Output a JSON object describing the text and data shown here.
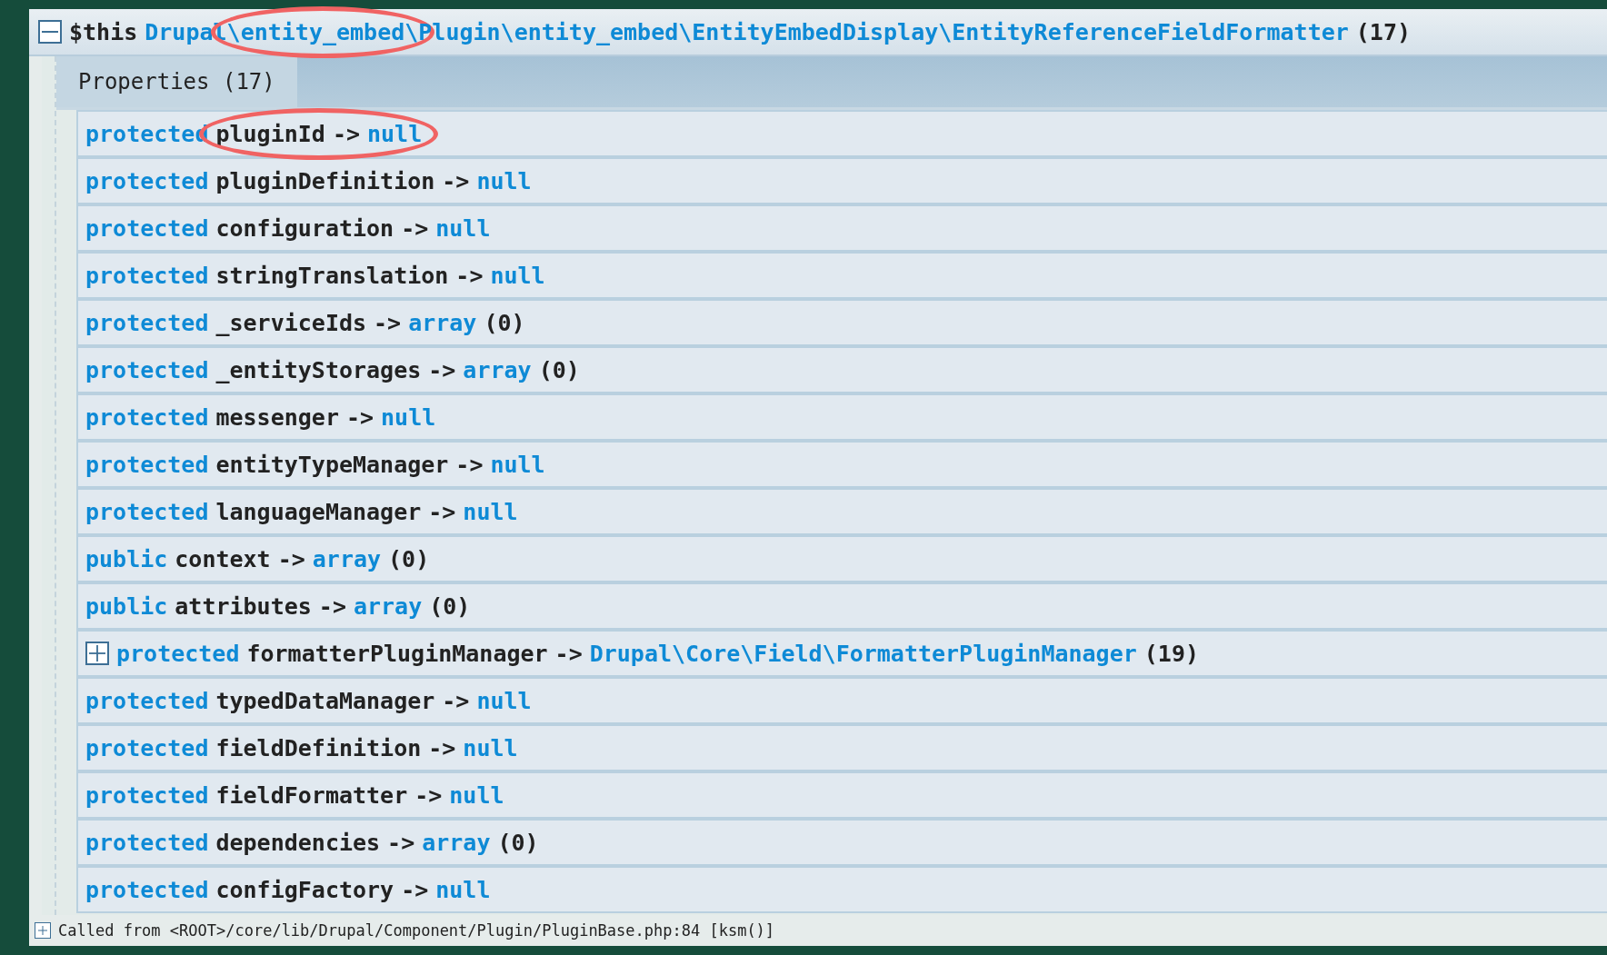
{
  "header": {
    "expanded": true,
    "variable": "$this",
    "type_parts": [
      {
        "text": "Drupal",
        "circled": false
      },
      {
        "text": "\\entity_embed\\",
        "circled": true
      },
      {
        "text": "Plugin\\entity_embed\\EntityEmbedDisplay\\EntityReferenceFieldFormatter",
        "circled": false
      }
    ],
    "count": "(17)"
  },
  "tabs": [
    {
      "label": "Properties (17)",
      "selected": true
    }
  ],
  "properties": [
    {
      "kind": "leaf",
      "visibility": "protected",
      "name": "pluginId",
      "arrow": "->",
      "value": "null",
      "circled": true
    },
    {
      "kind": "leaf",
      "visibility": "protected",
      "name": "pluginDefinition",
      "arrow": "->",
      "value": "null",
      "circled": false
    },
    {
      "kind": "leaf",
      "visibility": "protected",
      "name": "configuration",
      "arrow": "->",
      "value": "null",
      "circled": false
    },
    {
      "kind": "leaf",
      "visibility": "protected",
      "name": "stringTranslation",
      "arrow": "->",
      "value": "null",
      "circled": false
    },
    {
      "kind": "leaf",
      "visibility": "protected",
      "name": "_serviceIds",
      "arrow": "->",
      "value": "array",
      "count": "(0)",
      "circled": false
    },
    {
      "kind": "leaf",
      "visibility": "protected",
      "name": "_entityStorages",
      "arrow": "->",
      "value": "array",
      "count": "(0)",
      "circled": false
    },
    {
      "kind": "leaf",
      "visibility": "protected",
      "name": "messenger",
      "arrow": "->",
      "value": "null",
      "circled": false
    },
    {
      "kind": "leaf",
      "visibility": "protected",
      "name": "entityTypeManager",
      "arrow": "->",
      "value": "null",
      "circled": false
    },
    {
      "kind": "leaf",
      "visibility": "protected",
      "name": "languageManager",
      "arrow": "->",
      "value": "null",
      "circled": false
    },
    {
      "kind": "leaf",
      "visibility": "public",
      "name": "context",
      "arrow": "->",
      "value": "array",
      "count": "(0)",
      "circled": false
    },
    {
      "kind": "leaf",
      "visibility": "public",
      "name": "attributes",
      "arrow": "->",
      "value": "array",
      "count": "(0)",
      "circled": false
    },
    {
      "kind": "expandable",
      "expanded": false,
      "visibility": "protected",
      "name": "formatterPluginManager",
      "arrow": "->",
      "value": "Drupal\\Core\\Field\\FormatterPluginManager",
      "count": "(19)",
      "circled": false
    },
    {
      "kind": "leaf",
      "visibility": "protected",
      "name": "typedDataManager",
      "arrow": "->",
      "value": "null",
      "circled": false
    },
    {
      "kind": "leaf",
      "visibility": "protected",
      "name": "fieldDefinition",
      "arrow": "->",
      "value": "null",
      "circled": false
    },
    {
      "kind": "leaf",
      "visibility": "protected",
      "name": "fieldFormatter",
      "arrow": "->",
      "value": "null",
      "circled": false
    },
    {
      "kind": "leaf",
      "visibility": "protected",
      "name": "dependencies",
      "arrow": "->",
      "value": "array",
      "count": "(0)",
      "circled": false
    },
    {
      "kind": "leaf",
      "visibility": "protected",
      "name": "configFactory",
      "arrow": "->",
      "value": "null",
      "circled": false
    }
  ],
  "footer": {
    "expanded": false,
    "text": "Called from <ROOT>/core/lib/Drupal/Component/Plugin/PluginBase.php:84 [ksm()]"
  }
}
